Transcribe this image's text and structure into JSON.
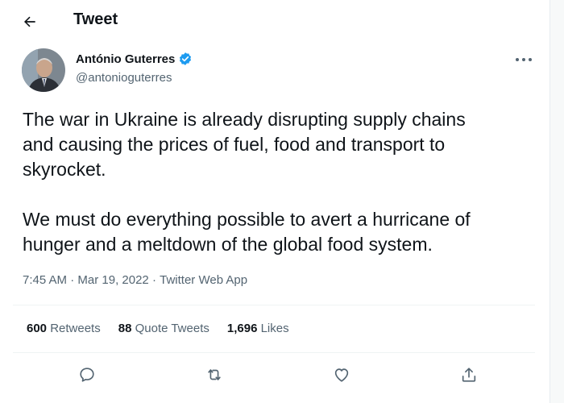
{
  "header": {
    "title": "Tweet",
    "back_icon": "arrow-left-icon"
  },
  "author": {
    "display_name": "António Guterres",
    "handle": "@antonioguterres",
    "verified_color": "#1d9bf0"
  },
  "tweet": {
    "text": "The war in Ukraine is already disrupting supply chains\nand causing the prices of fuel, food and transport to\nskyrocket.\n\nWe must do everything possible to avert a hurricane of\nhunger and a meltdown of the global food system.",
    "time": "7:45 AM",
    "separator": " · ",
    "date": "Mar 19, 2022",
    "source": "Twitter Web App"
  },
  "stats": {
    "retweets_count": "600",
    "retweets_label": " Retweets",
    "quotes_count": "88",
    "quotes_label": " Quote Tweets",
    "likes_count": "1,696",
    "likes_label": " Likes"
  },
  "actions": [
    "reply-icon",
    "retweet-icon",
    "like-icon",
    "share-icon"
  ],
  "colors": {
    "text": "#0f1419",
    "secondary": "#536471",
    "divider": "#eff3f4",
    "accent": "#1d9bf0"
  }
}
